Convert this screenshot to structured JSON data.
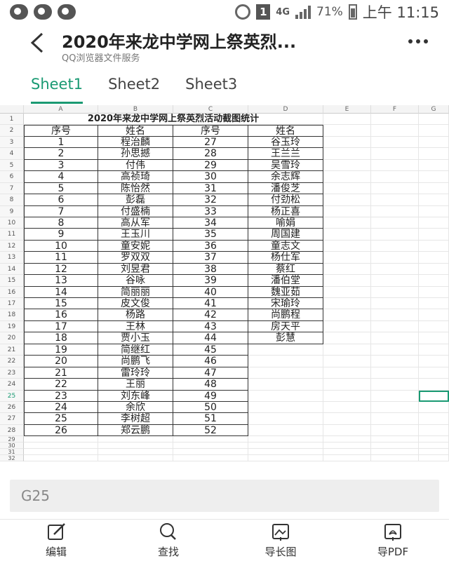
{
  "status_bar": {
    "network": "4G",
    "sim": "1",
    "battery": "71%",
    "time": "上午 11:15"
  },
  "header": {
    "title": "2020年来龙中学网上祭英烈...",
    "subtitle": "QQ浏览器文件服务"
  },
  "tabs": [
    {
      "label": "Sheet1",
      "active": true
    },
    {
      "label": "Sheet2",
      "active": false
    },
    {
      "label": "Sheet3",
      "active": false
    }
  ],
  "sheet": {
    "column_letters": [
      "A",
      "B",
      "C",
      "D",
      "E",
      "F",
      "G"
    ],
    "title": "2020年来龙中学网上祭英烈活动截图统计",
    "headers": [
      "序号",
      "姓名",
      "序号",
      "姓名"
    ],
    "rows": [
      [
        "1",
        "程治麟",
        "27",
        "谷玉玲"
      ],
      [
        "2",
        "孙思撼",
        "28",
        "王兰兰"
      ],
      [
        "3",
        "付伟",
        "29",
        "吴雪玲"
      ],
      [
        "4",
        "高祯琦",
        "30",
        "余志辉"
      ],
      [
        "5",
        "陈怡然",
        "31",
        "潘俊芝"
      ],
      [
        "6",
        "彭磊",
        "32",
        "付劲松"
      ],
      [
        "7",
        "付盛楠",
        "33",
        "杨正喜"
      ],
      [
        "8",
        "高从军",
        "34",
        "喻娟"
      ],
      [
        "9",
        "王玉川",
        "35",
        "周国建"
      ],
      [
        "10",
        "童安妮",
        "36",
        "童志文"
      ],
      [
        "11",
        "罗双双",
        "37",
        "杨仕军"
      ],
      [
        "12",
        "刘昱君",
        "38",
        "蔡红"
      ],
      [
        "13",
        "谷咏",
        "39",
        "潘伯堂"
      ],
      [
        "14",
        "简丽丽",
        "40",
        "魏亚茹"
      ],
      [
        "15",
        "皮文俊",
        "41",
        "宋瑜玲"
      ],
      [
        "16",
        "杨路",
        "42",
        "尚鹏程"
      ],
      [
        "17",
        "王林",
        "43",
        "房天平"
      ],
      [
        "18",
        "贾小玉",
        "44",
        "彭慧"
      ],
      [
        "19",
        "简继红",
        "45",
        ""
      ],
      [
        "20",
        "尚鹏飞",
        "46",
        ""
      ],
      [
        "21",
        "雷玲玲",
        "47",
        ""
      ],
      [
        "22",
        "王丽",
        "48",
        ""
      ],
      [
        "23",
        "刘东峰",
        "49",
        ""
      ],
      [
        "24",
        "余欣",
        "50",
        ""
      ],
      [
        "25",
        "李树超",
        "51",
        ""
      ],
      [
        "26",
        "郑云鹏",
        "52",
        ""
      ]
    ],
    "empty_row_numbers": [
      "29",
      "30",
      "31",
      "32"
    ],
    "selected_row": "25"
  },
  "cell_ref": "G25",
  "toolbar": [
    {
      "label": "编辑",
      "icon": "edit-icon"
    },
    {
      "label": "查找",
      "icon": "search-icon"
    },
    {
      "label": "导长图",
      "icon": "export-image-icon"
    },
    {
      "label": "导PDF",
      "icon": "export-pdf-icon"
    }
  ],
  "colors": {
    "accent": "#1a9a73"
  }
}
